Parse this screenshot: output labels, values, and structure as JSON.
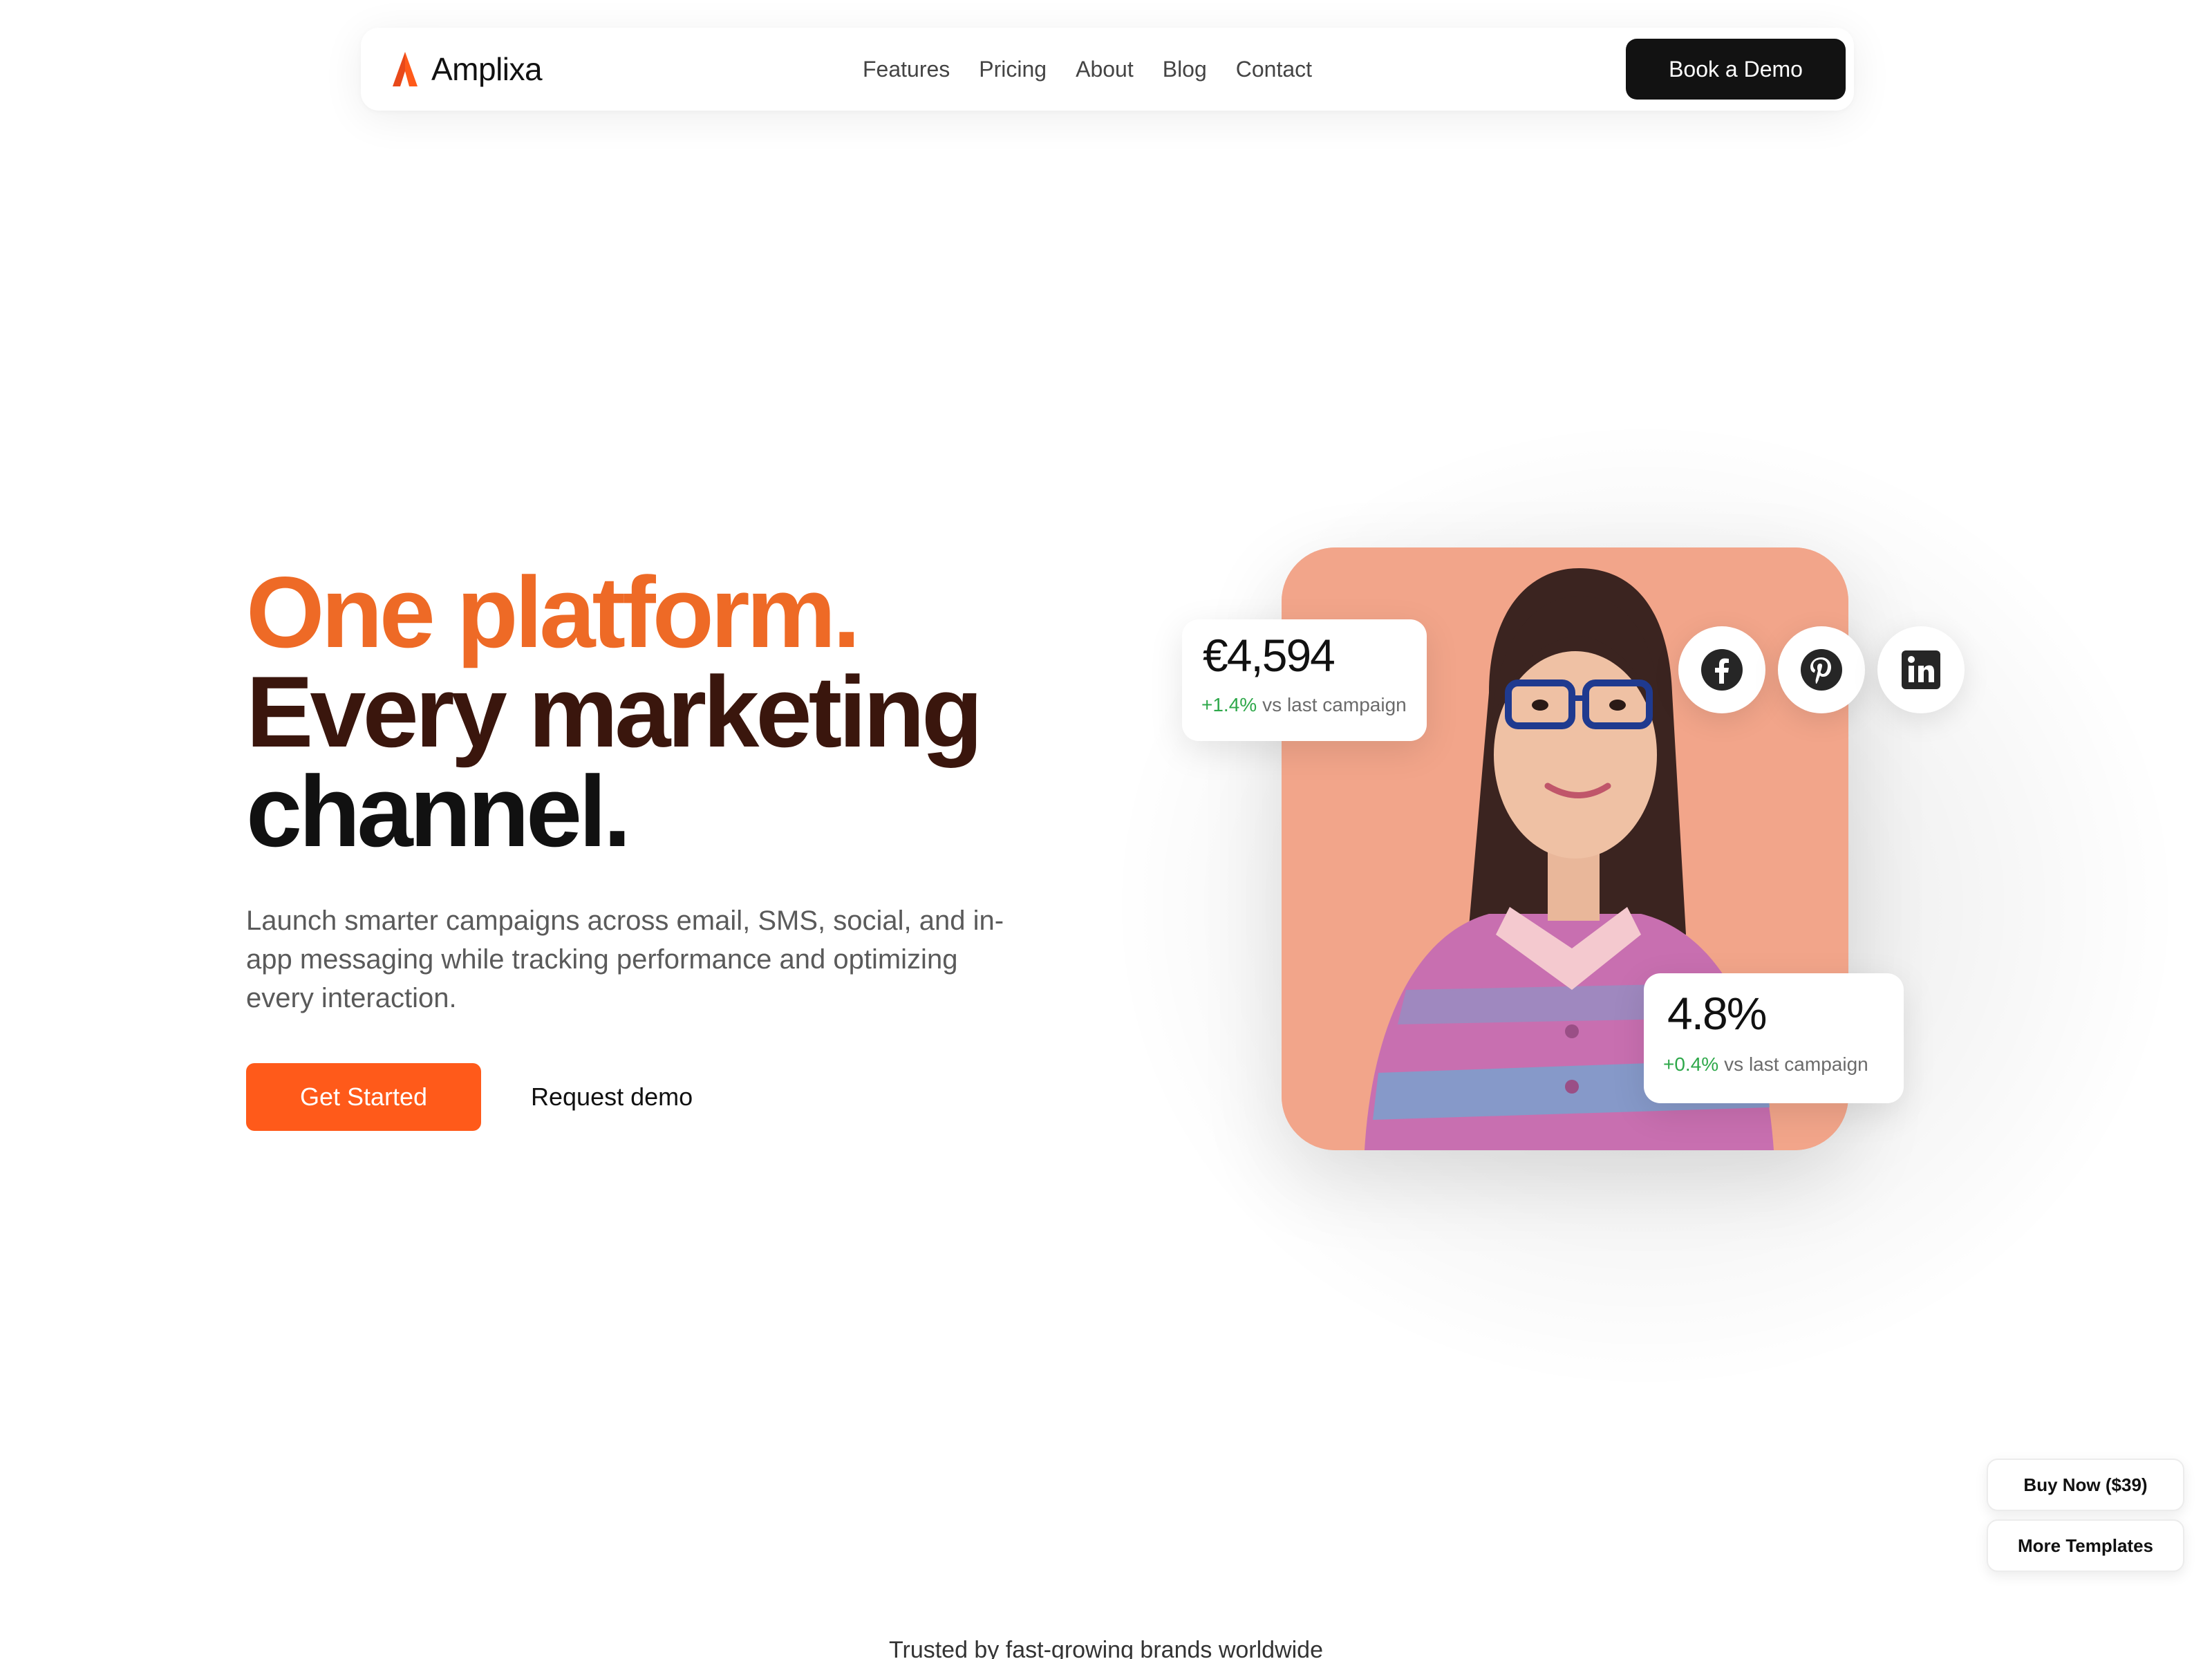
{
  "nav": {
    "brand": "Amplixa",
    "links": [
      "Features",
      "Pricing",
      "About",
      "Blog",
      "Contact"
    ],
    "cta": "Book a Demo"
  },
  "hero": {
    "headline": [
      "One platform.",
      "Every marketing",
      "channel."
    ],
    "subtext": "Launch smarter campaigns across email, SMS, social, and in-app messaging while tracking performance and optimizing every interaction.",
    "primary_button": "Get Started",
    "secondary_link": "Request demo"
  },
  "stats": [
    {
      "value": "€4,594",
      "delta": "+1.4%",
      "label": "vs last campaign"
    },
    {
      "value": "4.8%",
      "delta": "+0.4%",
      "label": "vs last campaign"
    }
  ],
  "social_icons": [
    "facebook-icon",
    "pinterest-icon",
    "linkedin-icon"
  ],
  "floating": {
    "buy": "Buy Now ($39)",
    "templates": "More Templates"
  },
  "trusted": "Trusted by fast-growing brands worldwide",
  "colors": {
    "accent": "#ff5a1a",
    "headline_orange": "#ee6a26",
    "headline_brown": "#3a160d",
    "positive": "#2ea84a",
    "photo_bg": "#f2a58a",
    "dark_button": "#121212"
  }
}
